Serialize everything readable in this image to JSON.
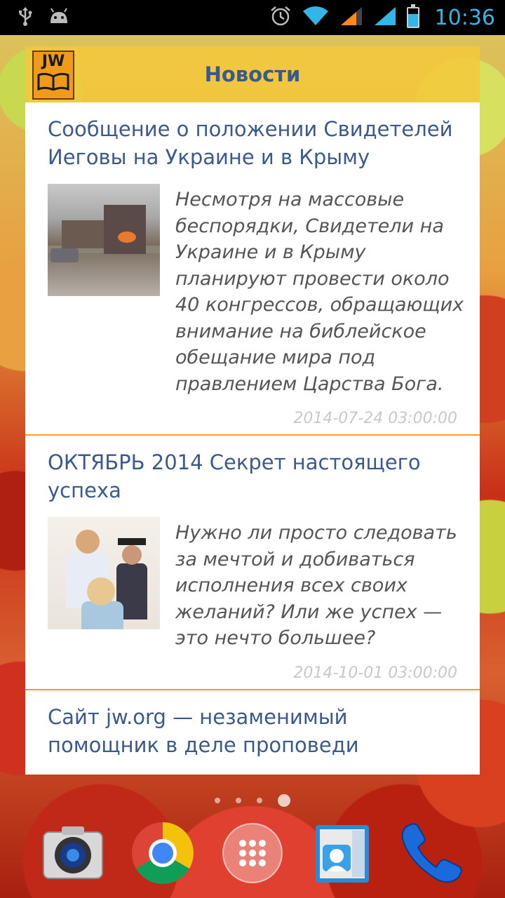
{
  "status_bar": {
    "time": "10:36",
    "icons": [
      "usb-icon",
      "android-debug-icon",
      "alarm-icon",
      "wifi-icon",
      "signal-icon",
      "signal-icon-2",
      "battery-charging-icon"
    ],
    "accent_color": "#33b5e5"
  },
  "widget": {
    "logo_text": "JW",
    "title": "Новости",
    "items": [
      {
        "title": "Сообщение о положении Свидетелей Иеговы на Украине и в Крыму",
        "summary": "Несмотря на массовые беспорядки, Свидетели на Украине и в Крыму планируют провести около 40 конгрессов, обращающих внимание на библейское обещание мира под правлением Царства Бога.",
        "date": "2014-07-24 03:00:00"
      },
      {
        "title": "ОКТЯБРЬ 2014 Секрет настоящего успеха",
        "summary": "Нужно ли просто следовать за мечтой и добиваться исполнения всех своих желаний? Или же успех — это нечто большее?",
        "date": "2014-10-01 03:00:00"
      },
      {
        "title": "Сайт jw.org — незаменимый помощник в деле проповеди"
      }
    ],
    "colors": {
      "title": "#3a5a8c",
      "divider": "#ff9a20",
      "date": "#c8c8c8"
    }
  },
  "dock": {
    "apps": [
      "camera-icon",
      "chrome-icon",
      "app-drawer-icon",
      "contacts-icon",
      "phone-icon"
    ]
  }
}
